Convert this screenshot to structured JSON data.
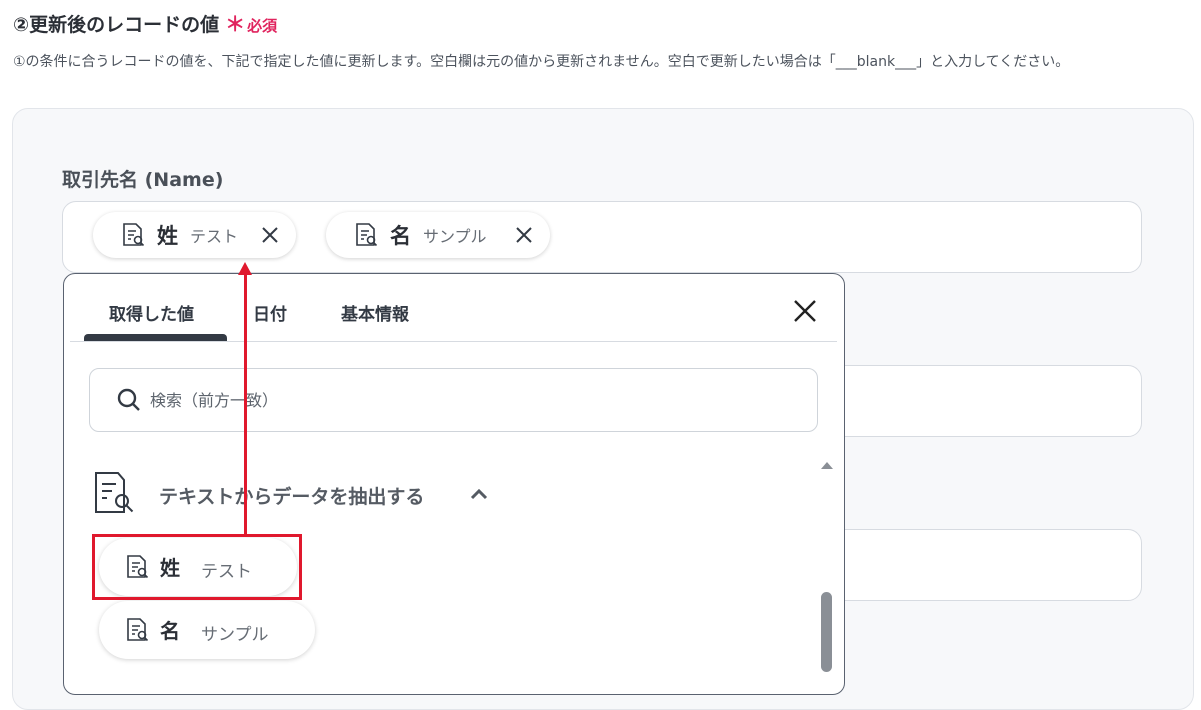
{
  "section": {
    "title": "②更新後のレコードの値",
    "required_mark": "＊",
    "required_label": "必須",
    "description": "①の条件に合うレコードの値を、下記で指定した値に更新します。空白欄は元の値から更新されません。空白で更新したい場合は「___blank___」と入力してください。"
  },
  "field": {
    "label": "取引先名 (Name)",
    "chips": [
      {
        "name": "姓",
        "value": "テスト",
        "icon": "document-search-icon"
      },
      {
        "name": "名",
        "value": "サンプル",
        "icon": "document-search-icon"
      }
    ]
  },
  "dropdown": {
    "tabs": [
      {
        "label": "取得した値",
        "active": true
      },
      {
        "label": "日付",
        "active": false
      },
      {
        "label": "基本情報",
        "active": false
      }
    ],
    "close_icon": "close-icon",
    "search": {
      "placeholder": "検索（前方一致）",
      "value": ""
    },
    "group": {
      "label": "テキストからデータを抽出する",
      "expanded": true
    },
    "items": [
      {
        "name": "姓",
        "value": "テスト",
        "highlighted": true
      },
      {
        "name": "名",
        "value": "サンプル",
        "highlighted": false
      }
    ]
  },
  "colors": {
    "required": "#e0245e",
    "highlight": "#e0182d",
    "panel_bg": "#f7f8fa"
  }
}
